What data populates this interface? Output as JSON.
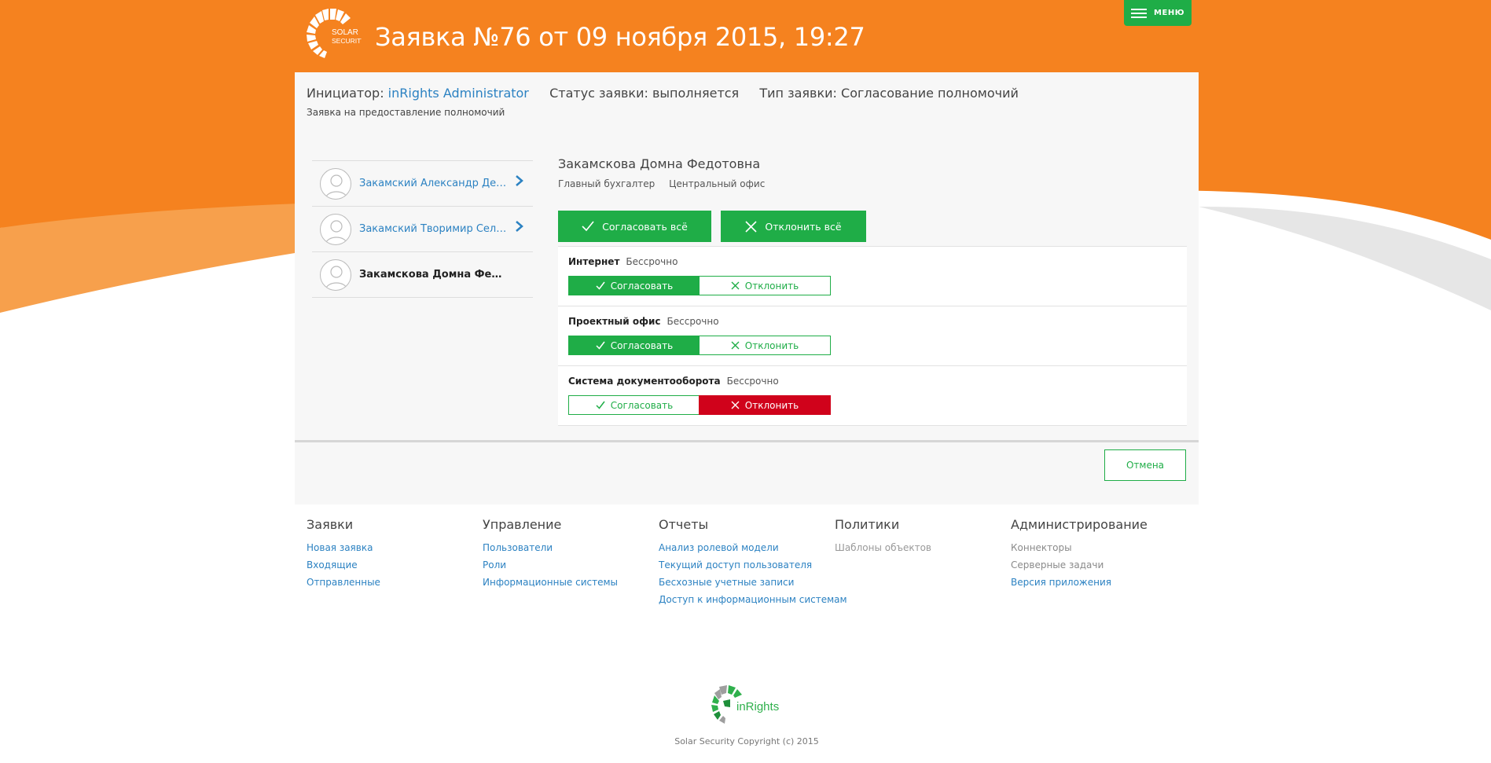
{
  "header": {
    "title": "Заявка №76 от 09 ноября 2015, 19:27",
    "logo_text": "SOLAR SECURITY",
    "menu_label": "МЕНЮ"
  },
  "request": {
    "initiator_label": "Инициатор:",
    "initiator_value": "inRights Administrator",
    "status_label": "Статус заявки:",
    "status_value": "выполняется",
    "type_label": "Тип заявки:",
    "type_value": "Согласование полномочий",
    "description": "Заявка на предоставление полномочий"
  },
  "users": [
    {
      "name": "Закамский Александр Денисов…",
      "active": false
    },
    {
      "name": "Закамский Творимир Селиван…",
      "active": false
    },
    {
      "name": "Закамскова Домна Федотов…",
      "active": true
    }
  ],
  "person": {
    "name": "Закамскова Домна Федотовна",
    "position": "Главный бухгалтер",
    "office": "Центральный офис",
    "approve_all": "Согласовать всё",
    "reject_all": "Отклонить всё"
  },
  "resources": [
    {
      "name": "Интернет",
      "term": "Бессрочно",
      "approve": "Согласовать",
      "reject": "Отклонить",
      "state": "approve"
    },
    {
      "name": "Проектный офис",
      "term": "Бессрочно",
      "approve": "Согласовать",
      "reject": "Отклонить",
      "state": "approve"
    },
    {
      "name": "Система документооборота",
      "term": "Бессрочно",
      "approve": "Согласовать",
      "reject": "Отклонить",
      "state": "reject"
    }
  ],
  "cancel_label": "Отмена",
  "footer": {
    "columns": [
      {
        "title": "Заявки",
        "links": [
          "Новая заявка",
          "Входящие",
          "Отправленные"
        ]
      },
      {
        "title": "Управление",
        "links": [
          "Пользователи",
          "Роли",
          "Информационные системы"
        ]
      },
      {
        "title": "Отчеты",
        "links": [
          "Анализ ролевой модели",
          "Текущий доступ пользователя",
          "Бесхозные учетные записи",
          "Доступ к информационным системам"
        ]
      },
      {
        "title": "Политики",
        "links": [
          "Шаблоны объектов"
        ]
      },
      {
        "title": "Администрирование",
        "links": [
          "Коннекторы",
          "Серверные задачи",
          "Версия приложения"
        ]
      }
    ],
    "brand": "inRights",
    "copyright": "Solar Security Copyright (c) 2015"
  },
  "colors": {
    "orange": "#f5821f",
    "green": "#1fad47",
    "red": "#d0021b",
    "link": "#2c82c2"
  },
  "icons": [
    "menu-icon",
    "check-icon",
    "cross-icon",
    "chevron-right-icon",
    "user-avatar-icon",
    "solar-logo-icon",
    "inrights-logo-icon"
  ]
}
